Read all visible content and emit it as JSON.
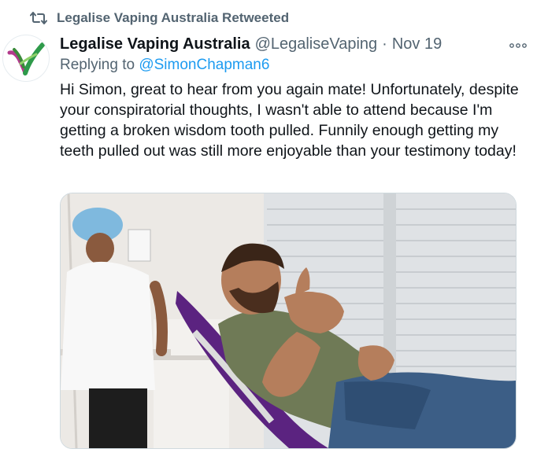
{
  "retweet": {
    "icon": "retweet-icon",
    "text": "Legalise Vaping Australia Retweeted"
  },
  "tweet": {
    "author_name": "Legalise Vaping Australia",
    "author_handle": "@LegaliseVaping",
    "separator": "·",
    "date": "Nov 19",
    "reply_prefix": "Replying to",
    "reply_to": "@SimonChapman6",
    "text": "Hi Simon, great to hear from you again mate! Unfortunately, despite your conspiratorial thoughts, I wasn't able to attend because I'm getting a broken wisdom tooth pulled. Funnily enough getting my teeth pulled out was still more enjoyable than your testimony today!",
    "more_icon": "more-options-icon"
  },
  "colors": {
    "link": "#1d9bf0",
    "muted": "#536471",
    "text": "#0f1419",
    "dental_chair": "#6a2d8f"
  }
}
